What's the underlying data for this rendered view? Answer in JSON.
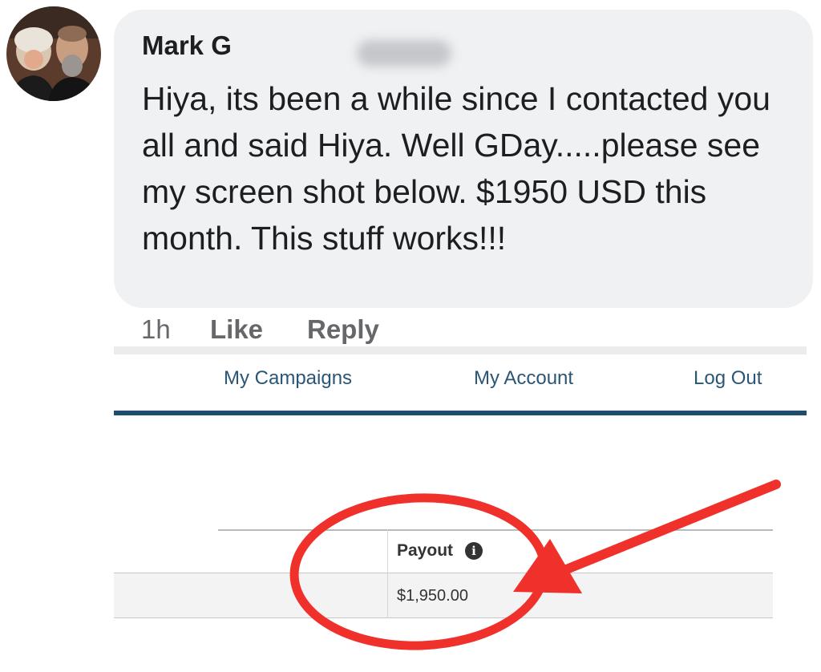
{
  "comment": {
    "author_visible": "Mark G",
    "text": "Hiya, its been a while since I contacted you all and said Hiya. Well GDay.....please see my screen shot below. $1950 USD this month. This stuff works!!!",
    "timestamp": "1h",
    "like_label": "Like",
    "reply_label": "Reply"
  },
  "dashboard": {
    "nav": [
      "My Campaigns",
      "My Account",
      "Log Out"
    ],
    "table": {
      "column_header": "Payout",
      "info_icon": "i",
      "value": "$1,950.00"
    }
  },
  "annotation": {
    "color": "#f0302a",
    "circle_icon": "red-circle-highlight",
    "arrow_icon": "red-arrow-pointer"
  },
  "colors": {
    "bubble": "#f0f1f3",
    "nav_text": "#2a5676",
    "nav_bar": "#1f4d6b",
    "meta_text": "#65676b"
  }
}
